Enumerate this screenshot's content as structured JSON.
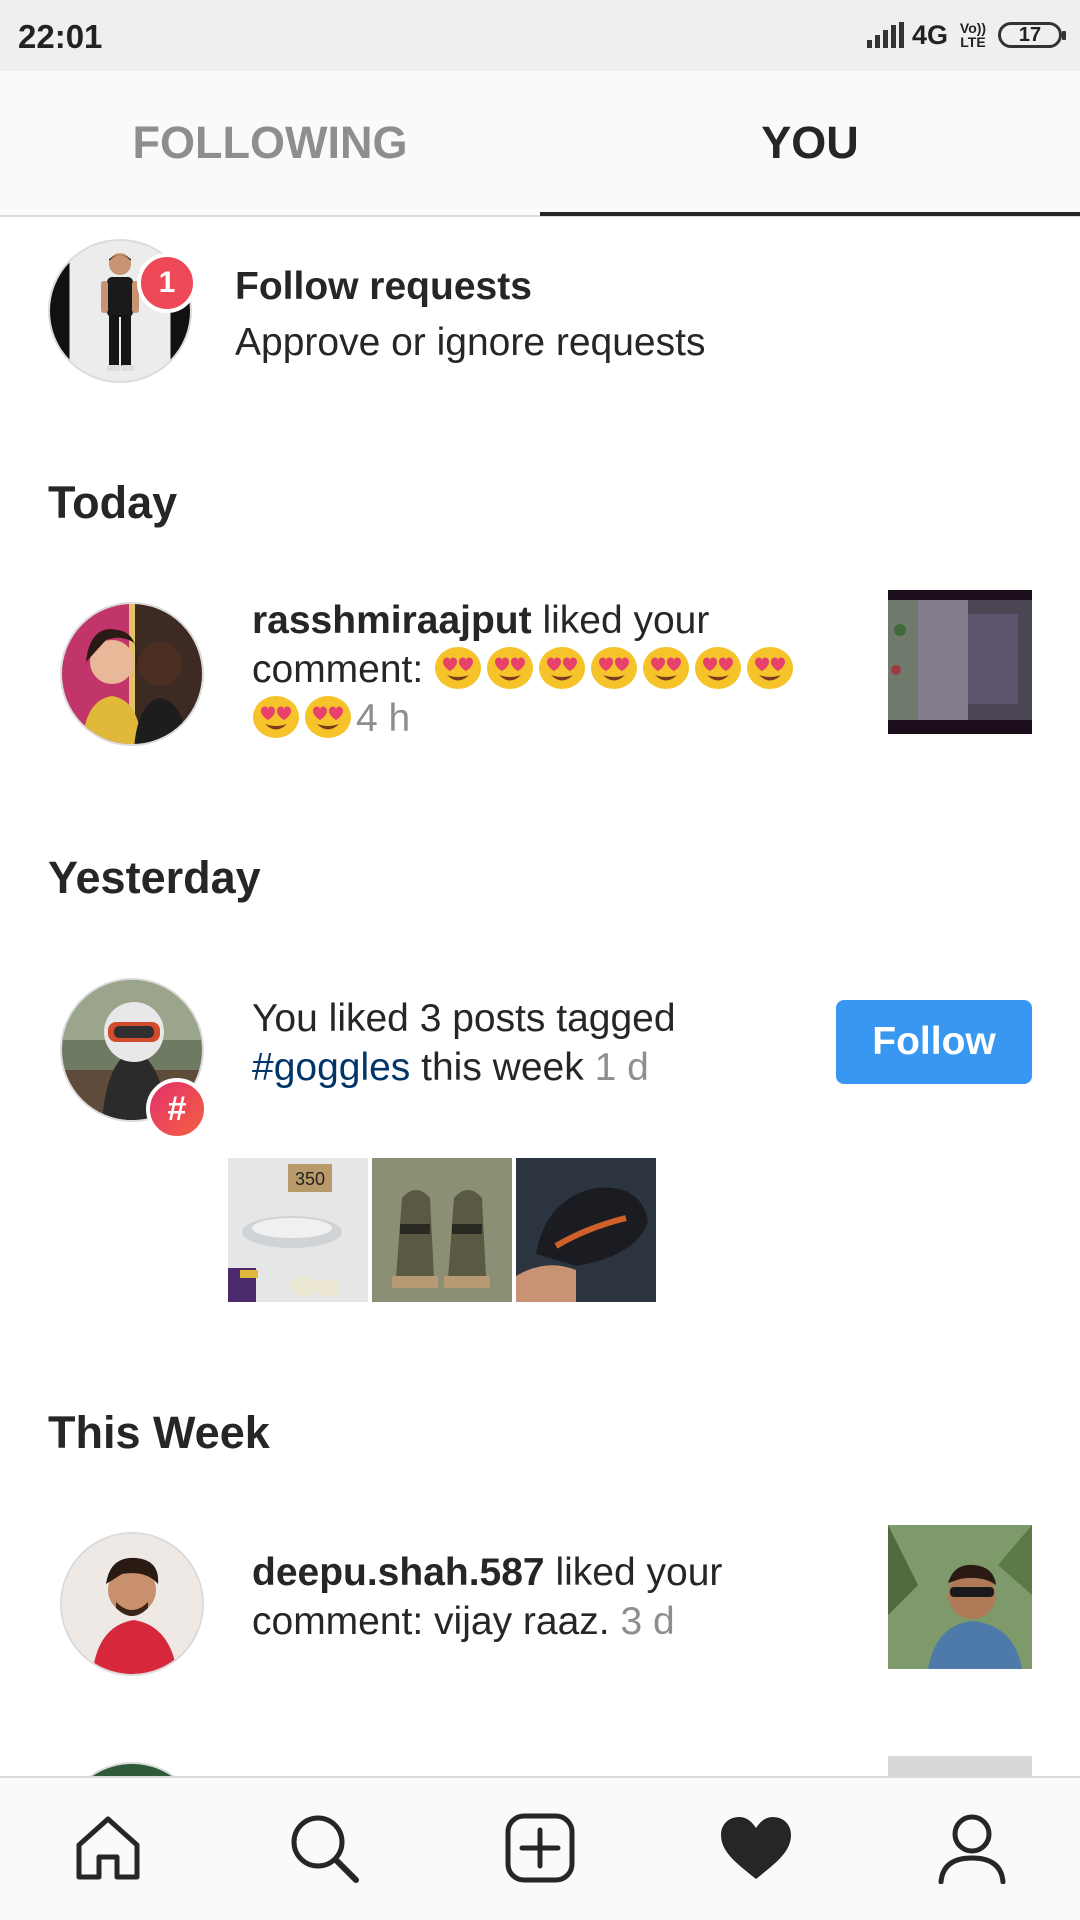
{
  "status_bar": {
    "time": "22:01",
    "network": "4G",
    "network_sub": "Vo)) LTE",
    "battery": "17"
  },
  "tabs": {
    "following": "FOLLOWING",
    "you": "YOU",
    "active": "you"
  },
  "follow_requests": {
    "count": "1",
    "title": "Follow requests",
    "subtitle": "Approve or ignore requests"
  },
  "sections": {
    "today": "Today",
    "yesterday": "Yesterday",
    "this_week": "This Week"
  },
  "notifications": {
    "today": [
      {
        "username": "rasshmiraajput",
        "action": " liked your comment: ",
        "emoji_name": "smiling-face-with-heart-eyes",
        "emoji_count": 9,
        "time": "4 h"
      }
    ],
    "yesterday": [
      {
        "text_before": "You liked 3 posts tagged ",
        "hashtag": "#goggles",
        "text_after": " this week ",
        "time": "1 d",
        "badge": "#",
        "button_label": "Follow"
      }
    ],
    "this_week": [
      {
        "username": "deepu.shah.587",
        "action": " liked your comment: vijay raaz. ",
        "time": "3 d"
      }
    ]
  },
  "tagged_post_labels": [
    "350"
  ],
  "bottom_nav": [
    {
      "name": "home",
      "icon": "home-icon"
    },
    {
      "name": "search",
      "icon": "search-icon"
    },
    {
      "name": "new-post",
      "icon": "add-post-icon"
    },
    {
      "name": "activity",
      "icon": "heart-icon",
      "active": true
    },
    {
      "name": "profile",
      "icon": "profile-icon"
    }
  ],
  "colors": {
    "accent": "#3897f0",
    "badge": "#ed4956",
    "hashtag_link": "#003569",
    "secondary_text": "#8e8e8e"
  }
}
